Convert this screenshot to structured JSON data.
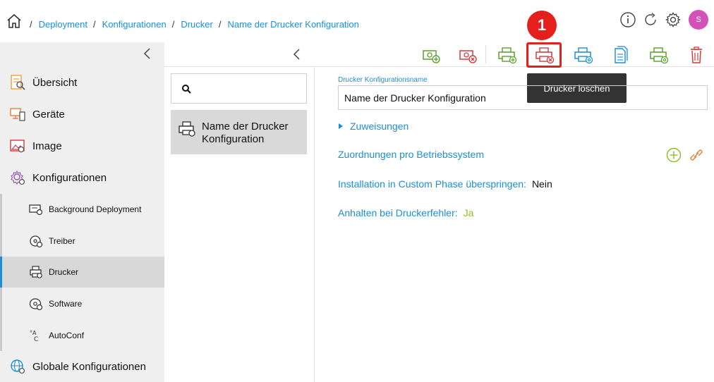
{
  "breadcrumb": {
    "items": [
      "Deployment",
      "Konfigurationen",
      "Drucker",
      "Name der Drucker Konfiguration"
    ],
    "separator": "/"
  },
  "user": {
    "initial": "S",
    "avatar_color": "#d452b8"
  },
  "sidebar": {
    "main_items": [
      {
        "label": "Übersicht",
        "icon": "overview-icon"
      },
      {
        "label": "Geräte",
        "icon": "devices-icon"
      },
      {
        "label": "Image",
        "icon": "image-icon"
      },
      {
        "label": "Konfigurationen",
        "icon": "configurations-icon"
      }
    ],
    "sub_items": [
      {
        "label": "Background Deployment",
        "icon": "background-deployment-icon"
      },
      {
        "label": "Treiber",
        "icon": "driver-icon"
      },
      {
        "label": "Drucker",
        "icon": "printer-icon",
        "active": true
      },
      {
        "label": "Software",
        "icon": "software-icon"
      },
      {
        "label": "AutoConf",
        "icon": "autoconf-icon"
      }
    ],
    "bottom_item": {
      "label": "Globale Konfigurationen",
      "icon": "globe-icon"
    }
  },
  "list": {
    "search_placeholder": "",
    "items": [
      {
        "label": "Name der Drucker Konfiguration"
      }
    ]
  },
  "toolbar": {
    "marker_number": "1",
    "tooltip": "Drucker löschen",
    "buttons": [
      "add-config-icon",
      "delete-config-icon",
      "add-printer-icon",
      "delete-printer-icon",
      "edit-printer-icon",
      "copy-icon",
      "assign-printer-icon",
      "trash-icon"
    ]
  },
  "detail": {
    "name_label": "Drucker Konfigurationsname",
    "name_value": "Name der Drucker Konfiguration",
    "zuweisungen": "Zuweisungen",
    "os_mapping": "Zuordnungen pro Betriebssystem",
    "skip_label": "Installation in Custom Phase überspringen:",
    "skip_value": "Nein",
    "halt_label": "Anhalten bei Druckerfehler:",
    "halt_value": "Ja"
  },
  "colors": {
    "accent": "#1a8fd8",
    "green": "#8cbf26",
    "red": "#e3201b"
  }
}
